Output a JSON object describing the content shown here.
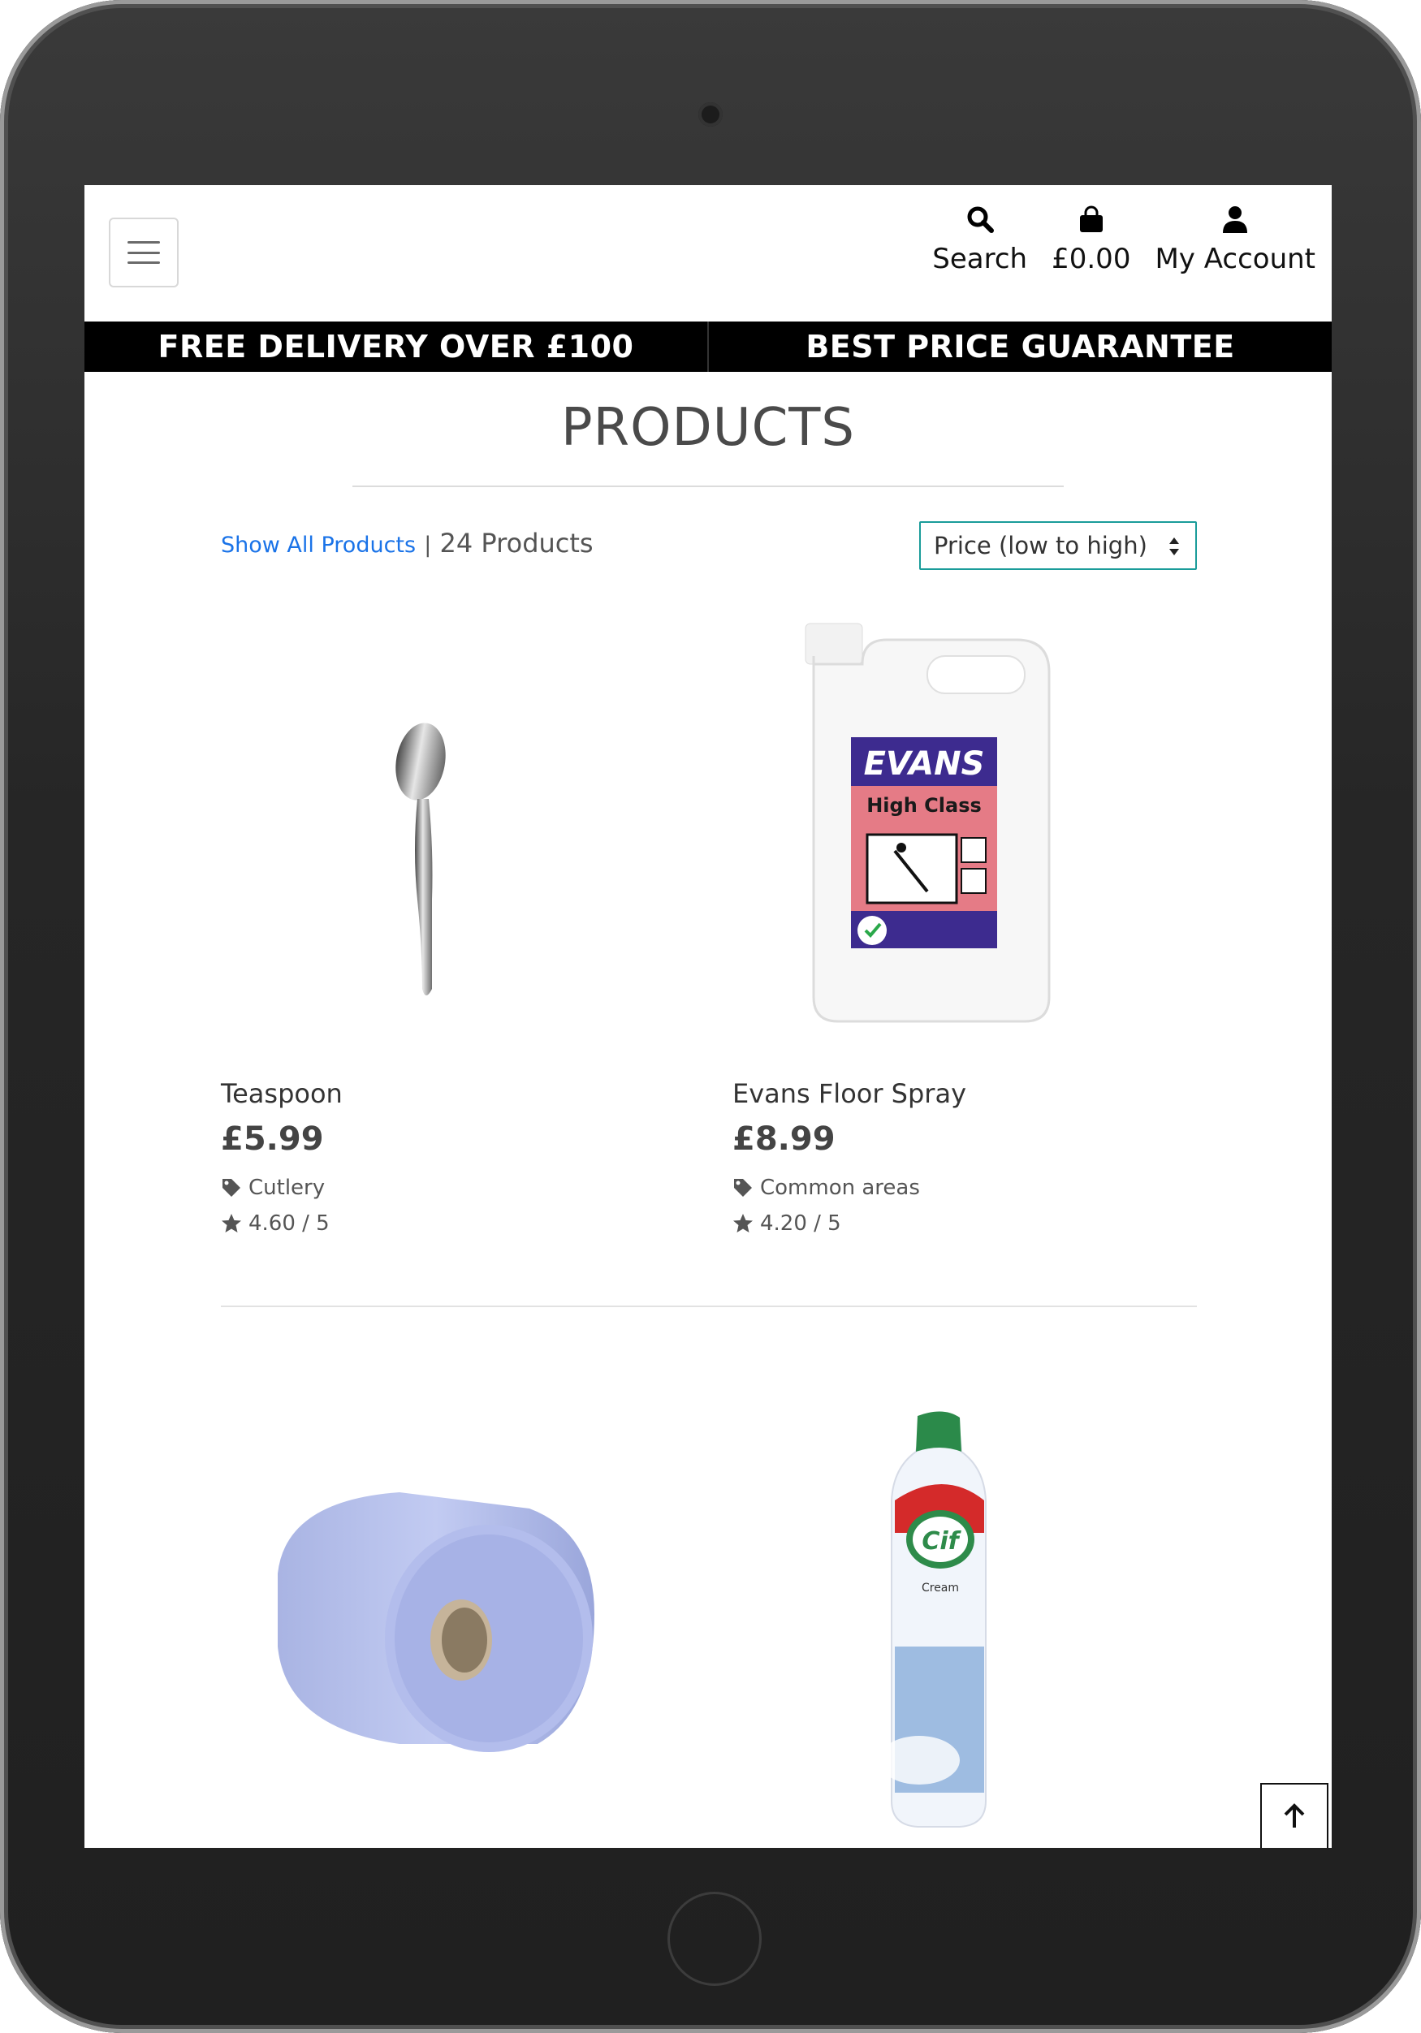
{
  "nav": {
    "menu_toggle": "",
    "links": [
      {
        "label": "Search",
        "icon": "search-icon"
      },
      {
        "label": "£0.00",
        "icon": "shopping-bag-icon"
      },
      {
        "label": "My Account",
        "icon": "user-icon"
      }
    ]
  },
  "banner": {
    "left": "FREE DELIVERY OVER £100",
    "right": "BEST PRICE GUARANTEE"
  },
  "page_title": "PRODUCTS",
  "toolbar": {
    "show_all": "Show All Products",
    "separator": "|",
    "count": "24 Products",
    "sort": "Price (low to high)"
  },
  "products": [
    {
      "name": "Teaspoon",
      "price": "£5.99",
      "category": "Cutlery",
      "rating": "4.60 / 5"
    },
    {
      "name": "Evans Floor Spray",
      "price": "£8.99",
      "category": "Common areas",
      "rating": "4.20 / 5"
    },
    {
      "name": "",
      "price": "",
      "category": "",
      "rating": ""
    },
    {
      "name": "",
      "price": "",
      "category": "",
      "rating": ""
    }
  ],
  "product_image_text": {
    "evans_brand": "EVANS",
    "evans_line": "High Class",
    "cif_brand": "Cif",
    "cif_desc": "Cream"
  },
  "colors": {
    "link": "#1a73e8",
    "sort_border": "#1a9c9a",
    "banner_bg": "#000000"
  }
}
